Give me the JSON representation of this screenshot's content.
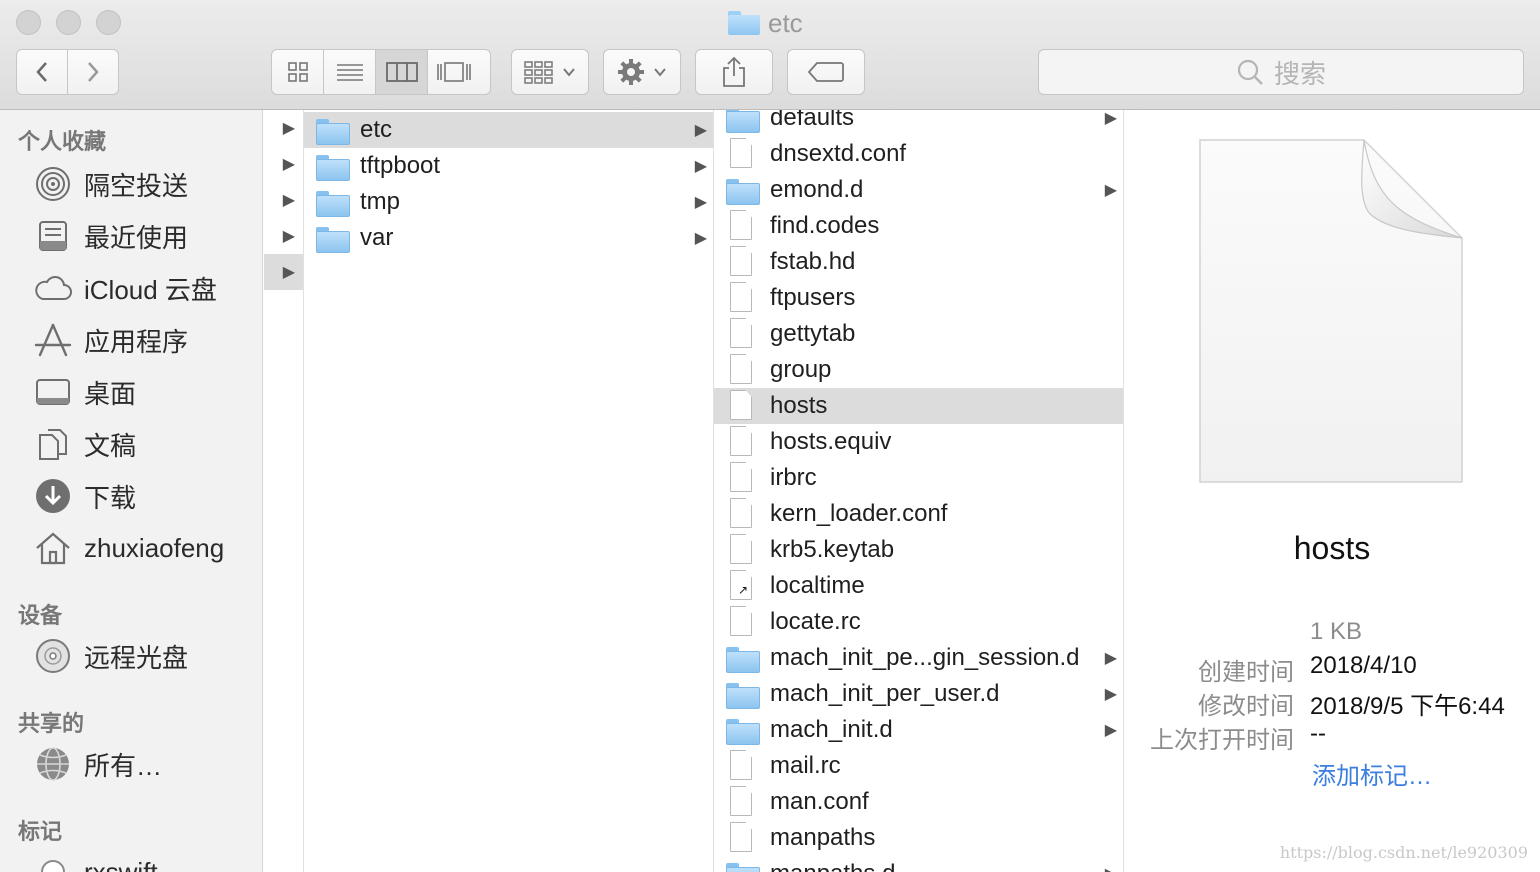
{
  "window": {
    "title": "etc"
  },
  "toolbar": {
    "back_icon": "chevron-left-icon",
    "forward_icon": "chevron-right-icon",
    "view_modes": [
      "icon-view",
      "list-view",
      "column-view",
      "gallery-view"
    ],
    "active_view": "column-view",
    "search_placeholder": "搜索"
  },
  "sidebar": {
    "sections": [
      {
        "header": "个人收藏",
        "items": [
          {
            "label": "隔空投送",
            "icon": "airdrop-icon"
          },
          {
            "label": "最近使用",
            "icon": "recents-icon"
          },
          {
            "label": "iCloud 云盘",
            "icon": "cloud-icon"
          },
          {
            "label": "应用程序",
            "icon": "applications-icon"
          },
          {
            "label": "桌面",
            "icon": "desktop-icon"
          },
          {
            "label": "文稿",
            "icon": "documents-icon"
          },
          {
            "label": "下载",
            "icon": "downloads-icon"
          },
          {
            "label": "zhuxiaofeng",
            "icon": "home-icon"
          }
        ]
      },
      {
        "header": "设备",
        "items": [
          {
            "label": "远程光盘",
            "icon": "disc-icon"
          }
        ]
      },
      {
        "header": "共享的",
        "items": [
          {
            "label": "所有…",
            "icon": "network-icon"
          }
        ]
      },
      {
        "header": "标记",
        "items": [
          {
            "label": "rxswift",
            "icon": "tag-icon"
          }
        ]
      }
    ]
  },
  "column1": {
    "items": [
      {
        "name": "etc",
        "type": "folder",
        "selected": true
      },
      {
        "name": "tftpboot",
        "type": "folder"
      },
      {
        "name": "tmp",
        "type": "folder"
      },
      {
        "name": "var",
        "type": "folder"
      }
    ]
  },
  "column2": {
    "items": [
      {
        "name": "defaults",
        "type": "folder"
      },
      {
        "name": "dnsextd.conf",
        "type": "file"
      },
      {
        "name": "emond.d",
        "type": "folder"
      },
      {
        "name": "find.codes",
        "type": "file"
      },
      {
        "name": "fstab.hd",
        "type": "file"
      },
      {
        "name": "ftpusers",
        "type": "file"
      },
      {
        "name": "gettytab",
        "type": "file"
      },
      {
        "name": "group",
        "type": "file"
      },
      {
        "name": "hosts",
        "type": "file",
        "selected": true
      },
      {
        "name": "hosts.equiv",
        "type": "file"
      },
      {
        "name": "irbrc",
        "type": "file"
      },
      {
        "name": "kern_loader.conf",
        "type": "file"
      },
      {
        "name": "krb5.keytab",
        "type": "file"
      },
      {
        "name": "localtime",
        "type": "alias"
      },
      {
        "name": "locate.rc",
        "type": "file"
      },
      {
        "name": "mach_init_pe...gin_session.d",
        "type": "folder"
      },
      {
        "name": "mach_init_per_user.d",
        "type": "folder"
      },
      {
        "name": "mach_init.d",
        "type": "folder"
      },
      {
        "name": "mail.rc",
        "type": "file"
      },
      {
        "name": "man.conf",
        "type": "file"
      },
      {
        "name": "manpaths",
        "type": "file"
      },
      {
        "name": "manpaths.d",
        "type": "folder"
      }
    ]
  },
  "preview": {
    "name": "hosts",
    "size": "1 KB",
    "created_label": "创建时间",
    "created_value": "2018/4/10",
    "modified_label": "修改时间",
    "modified_value": "2018/9/5 下午6:44",
    "opened_label": "上次打开时间",
    "opened_value": "--",
    "add_tags": "添加标记…"
  },
  "watermark": "https://blog.csdn.net/le920309"
}
